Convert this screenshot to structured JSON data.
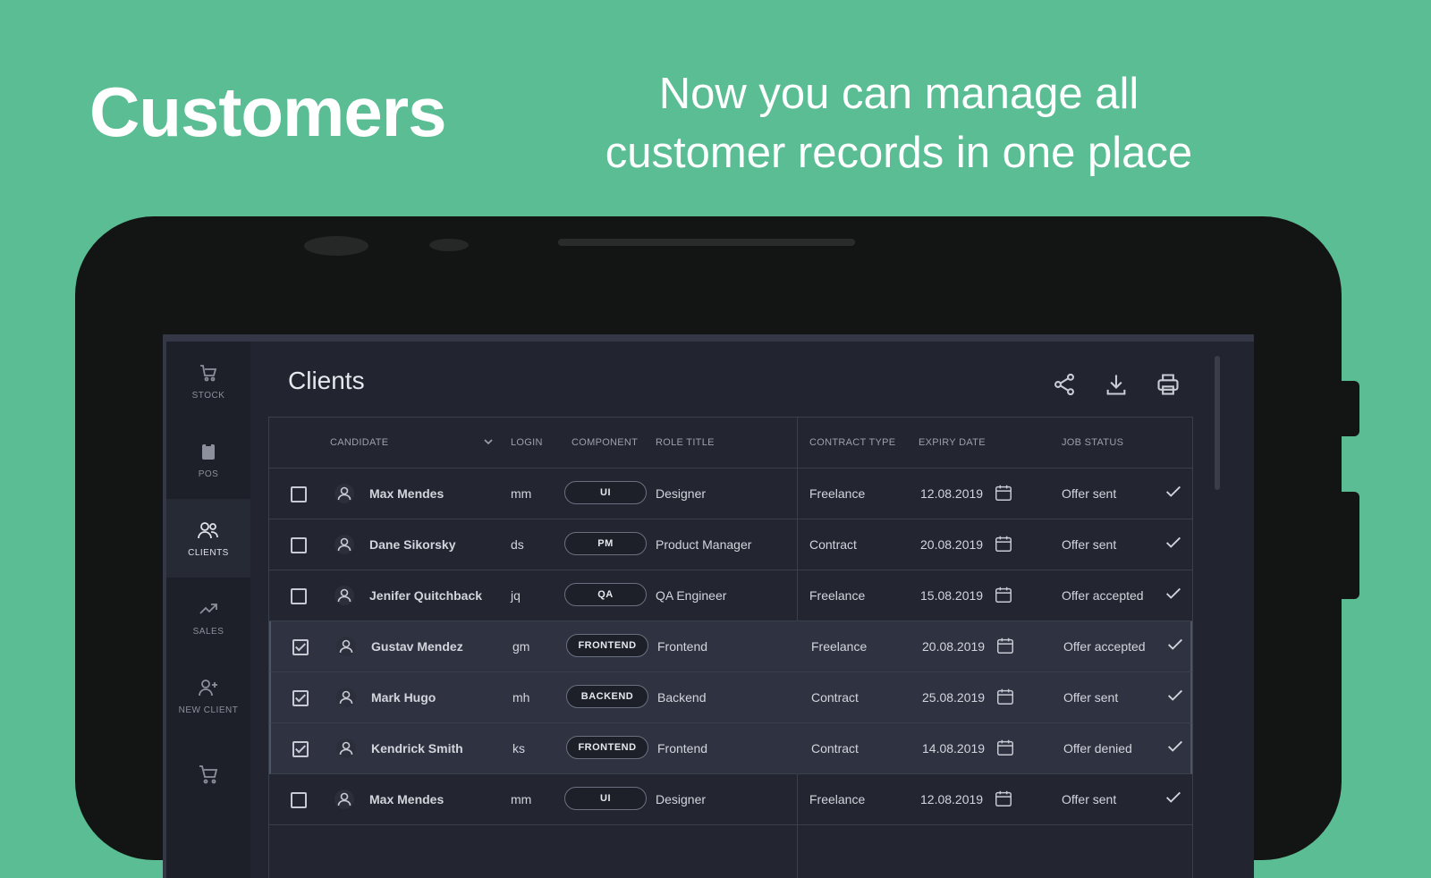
{
  "promo": {
    "headline": "Customers",
    "tagline_line1": "Now you can manage all",
    "tagline_line2": "customer records in one place"
  },
  "colors": {
    "background": "#5abd93",
    "device": "#131414",
    "screen": "#22252f",
    "nav": "#1d2029"
  },
  "nav": {
    "items": [
      {
        "label": "STOCK",
        "icon": "cart-icon",
        "active": false
      },
      {
        "label": "POS",
        "icon": "clipboard-icon",
        "active": false
      },
      {
        "label": "CLIENTS",
        "icon": "users-icon",
        "active": true
      },
      {
        "label": "SALES",
        "icon": "trending-up-icon",
        "active": false
      },
      {
        "label": "NEW CLIENT",
        "icon": "add-user-icon",
        "active": false
      },
      {
        "label": "",
        "icon": "shopping-cart-icon",
        "active": false
      }
    ]
  },
  "page": {
    "title": "Clients",
    "toolbar": [
      "share-icon",
      "download-icon",
      "print-icon"
    ]
  },
  "table": {
    "columns": {
      "candidate": "CANDIDATE",
      "login": "LOGIN",
      "component": "COMPONENT",
      "role_title": "ROLE TITLE",
      "contract_type": "CONTRACT TYPE",
      "expiry_date": "EXPIRY DATE",
      "job_status": "JOB STATUS"
    },
    "rows": [
      {
        "checked": false,
        "name": "Max Mendes",
        "login": "mm",
        "component": "UI",
        "role": "Designer",
        "contract": "Freelance",
        "expiry": "12.08.2019",
        "status": "Offer sent"
      },
      {
        "checked": false,
        "name": "Dane Sikorsky",
        "login": "ds",
        "component": "PM",
        "role": "Product Manager",
        "contract": "Contract",
        "expiry": "20.08.2019",
        "status": "Offer sent"
      },
      {
        "checked": false,
        "name": "Jenifer Quitchback",
        "login": "jq",
        "component": "QA",
        "role": "QA Engineer",
        "contract": "Freelance",
        "expiry": "15.08.2019",
        "status": "Offer accepted"
      },
      {
        "checked": true,
        "name": "Gustav Mendez",
        "login": "gm",
        "component": "FRONTEND",
        "role": "Frontend",
        "contract": "Freelance",
        "expiry": "20.08.2019",
        "status": "Offer accepted"
      },
      {
        "checked": true,
        "name": "Mark Hugo",
        "login": "mh",
        "component": "BACKEND",
        "role": "Backend",
        "contract": "Contract",
        "expiry": "25.08.2019",
        "status": "Offer sent"
      },
      {
        "checked": true,
        "name": "Kendrick Smith",
        "login": "ks",
        "component": "FRONTEND",
        "role": "Frontend",
        "contract": "Contract",
        "expiry": "14.08.2019",
        "status": "Offer denied"
      },
      {
        "checked": false,
        "name": "Max Mendes",
        "login": "mm",
        "component": "UI",
        "role": "Designer",
        "contract": "Freelance",
        "expiry": "12.08.2019",
        "status": "Offer sent"
      }
    ]
  }
}
